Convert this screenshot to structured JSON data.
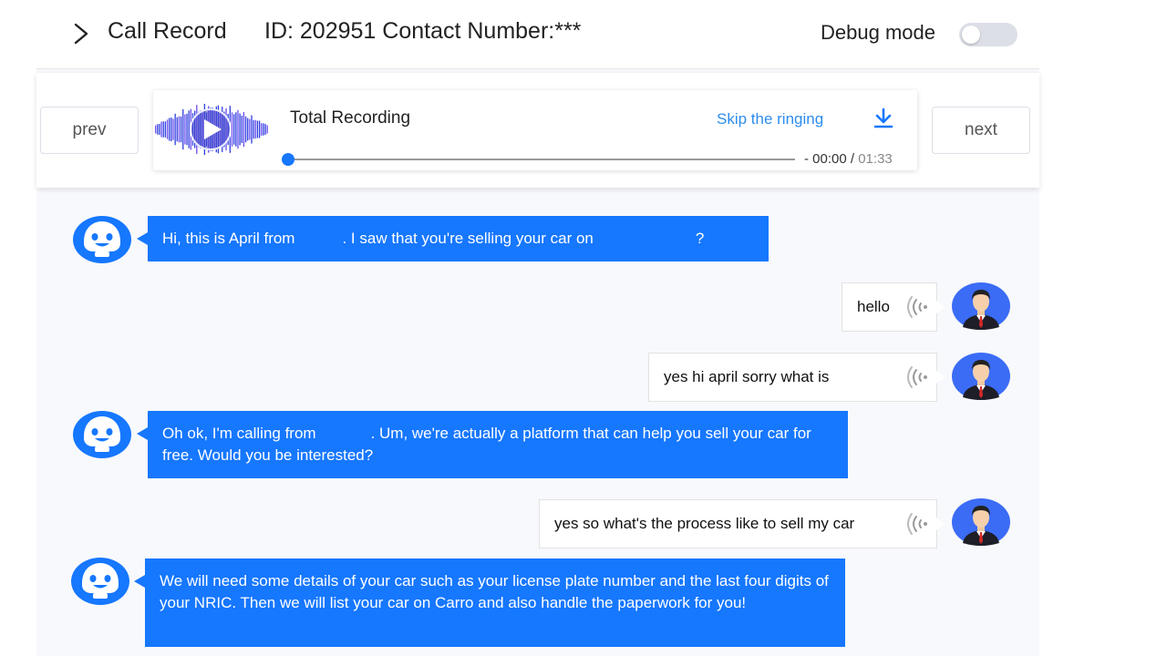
{
  "header": {
    "title": "Call Record",
    "id_text": "ID: 202951 Contact Number:***",
    "debug_label": "Debug mode",
    "debug_on": false
  },
  "nav": {
    "prev_label": "prev",
    "next_label": "next"
  },
  "player": {
    "title": "Total Recording",
    "skip_label": "Skip the ringing",
    "current_time": "- 00:00 /",
    "duration": "01:33",
    "progress": 0,
    "icons": [
      "play-icon",
      "download-icon",
      "chevron-right-icon"
    ]
  },
  "colors": {
    "accent": "#1677ff",
    "link": "#2d8cf0",
    "avatar_bg": "#3b82f6",
    "waveform": "#3b3bd8"
  },
  "messages": [
    {
      "speaker": "bot",
      "segments": [
        "Hi, this is April from",
        ". I saw that you're selling your car on",
        "?"
      ]
    },
    {
      "speaker": "user",
      "text": "hello"
    },
    {
      "speaker": "user",
      "text": "yes hi april sorry what is"
    },
    {
      "speaker": "bot",
      "segments": [
        "Oh ok, I'm calling from",
        ". Um, we're actually a platform that can help you sell your car for free. Would you be interested?"
      ]
    },
    {
      "speaker": "user",
      "text": "yes so what's the process like to sell my car"
    },
    {
      "speaker": "bot",
      "segments": [
        "We will need some details of your car such as your license plate number and the last four digits of your NRIC. Then we will list your car on Carro and also handle the paperwork for you!"
      ]
    }
  ]
}
